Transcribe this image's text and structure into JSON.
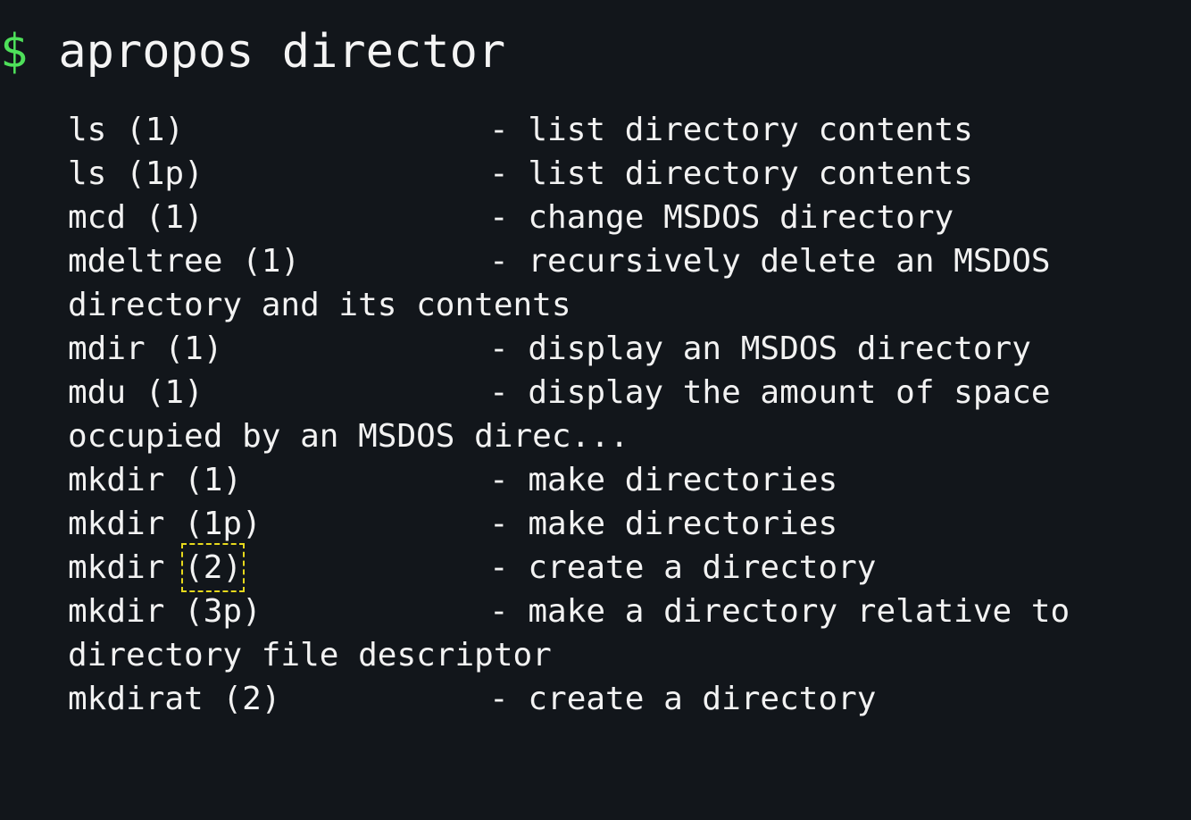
{
  "prompt": {
    "symbol": "$",
    "command": "apropos director"
  },
  "results": [
    {
      "name": "ls",
      "section": "(1)",
      "description": "- list directory contents"
    },
    {
      "name": "ls",
      "section": "(1p)",
      "description": "- list directory contents"
    },
    {
      "name": "mcd",
      "section": "(1)",
      "description": "- change MSDOS directory"
    },
    {
      "name": "mdeltree",
      "section": "(1)",
      "description": "- recursively delete an MSDOS",
      "continuation": "directory and its contents"
    },
    {
      "name": "mdir",
      "section": "(1)",
      "description": "- display an MSDOS directory"
    },
    {
      "name": "mdu",
      "section": "(1)",
      "description": "- display the amount of space",
      "continuation": "occupied by an MSDOS direc..."
    },
    {
      "name": "mkdir",
      "section": "(1)",
      "description": "- make directories"
    },
    {
      "name": "mkdir",
      "section": "(1p)",
      "description": "- make directories"
    },
    {
      "name": "mkdir",
      "section": "(2)",
      "description": "- create a directory",
      "highlighted": true
    },
    {
      "name": "mkdir",
      "section": "(3p)",
      "description": "- make a directory relative to",
      "continuation": "directory file descriptor"
    },
    {
      "name": "mkdirat",
      "section": "(2)",
      "description": "- create a directory"
    }
  ],
  "colors": {
    "background": "#12161b",
    "prompt_symbol": "#4ee05a",
    "text": "#f2f2f2",
    "highlight_box": "#e6d81c"
  }
}
